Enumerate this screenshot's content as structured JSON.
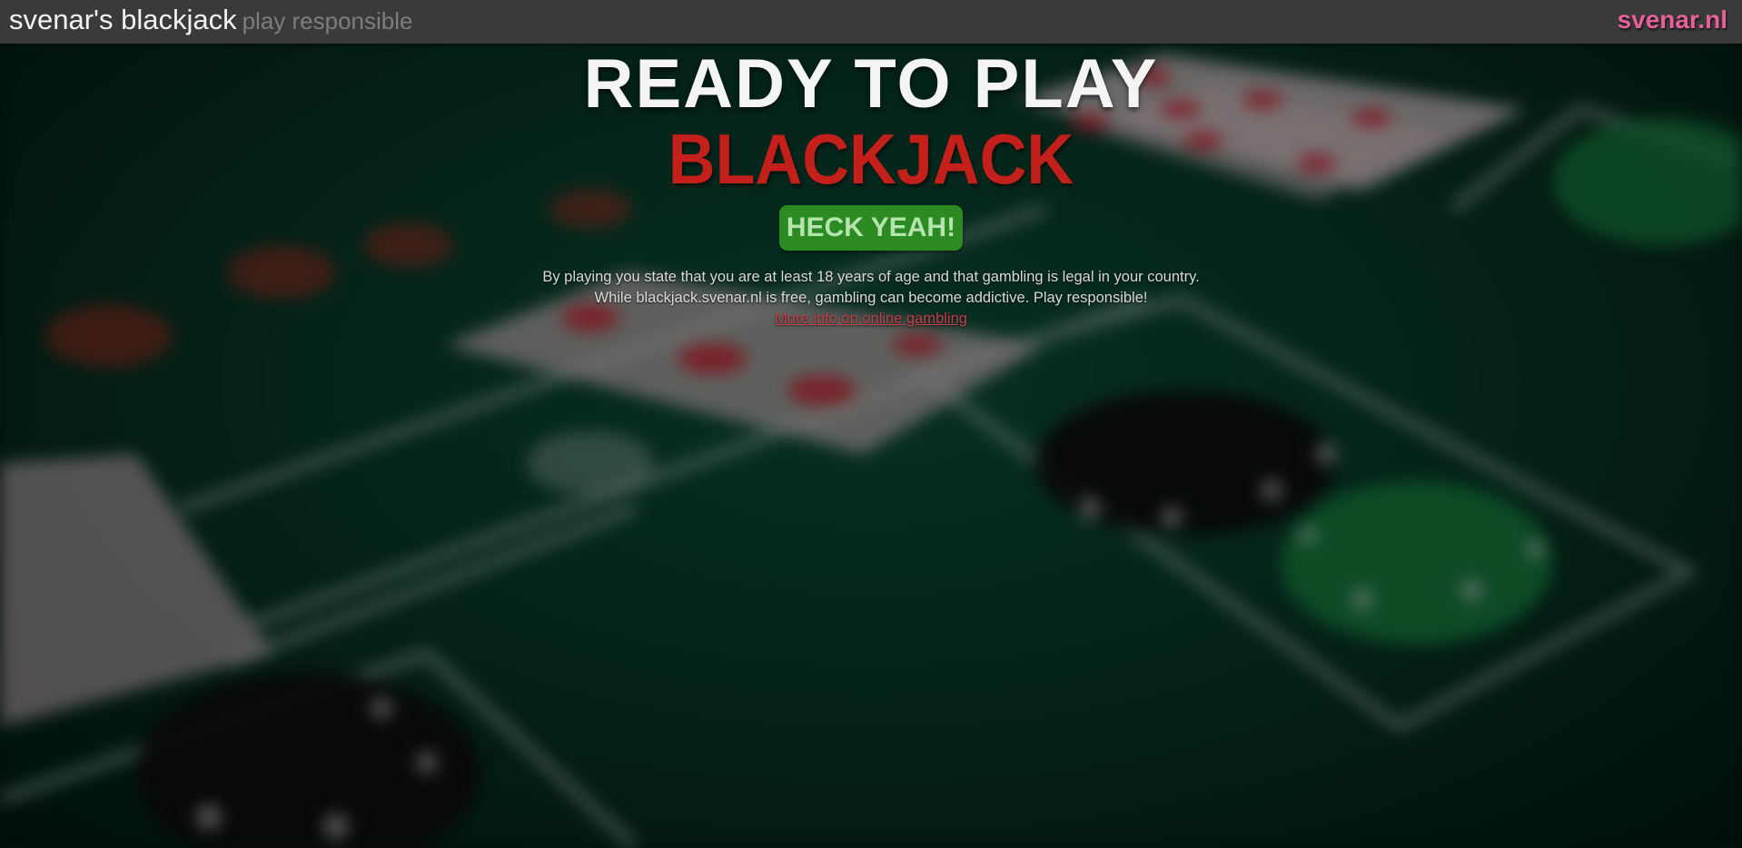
{
  "header": {
    "title": "svenar's blackjack",
    "tagline": "play responsible",
    "site_link": "svenar.nl"
  },
  "hero": {
    "title": "READY TO PLAY",
    "logo_text": "BLACKJACK",
    "cta_label": "HECK YEAH!",
    "disclaimer_line1": "By playing you state that you are at least 18 years of age and that gambling is legal in your country.",
    "disclaimer_line2": "While blackjack.svenar.nl is free, gambling can become addictive. Play responsible!",
    "info_link": "More info on online gambling"
  },
  "colors": {
    "header_bg": "#3a3a3a",
    "site_link": "#e8609a",
    "logo_red": "#c4201b",
    "cta_green": "#2b8a22",
    "table_felt": "#073726"
  }
}
